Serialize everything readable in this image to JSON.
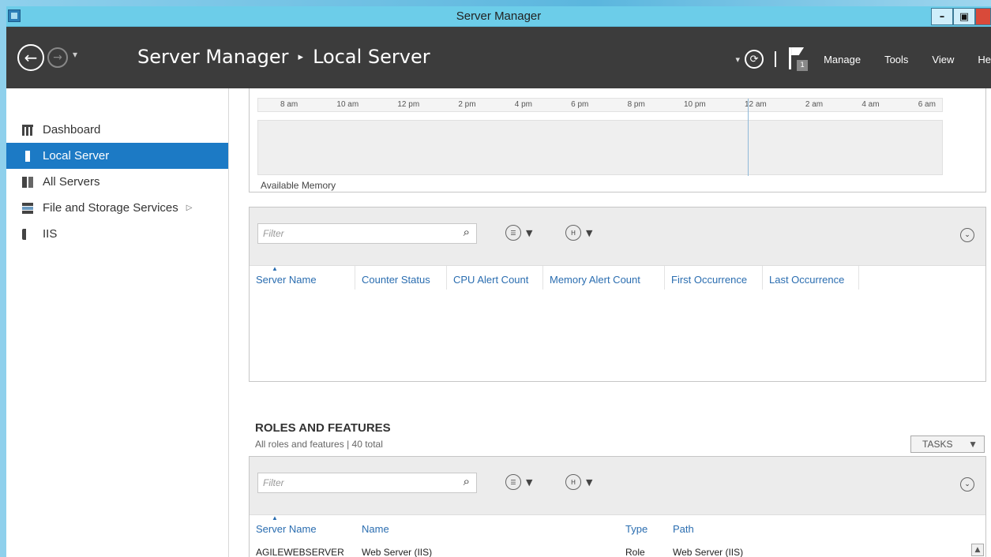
{
  "window": {
    "title": "Server Manager",
    "buttons": {
      "minimize": "–",
      "restore": "🗗",
      "close": ""
    }
  },
  "cmdbar": {
    "breadcrumb": [
      "Server Manager",
      "Local Server"
    ],
    "separator": "▸",
    "menus": [
      "Manage",
      "Tools",
      "View",
      "He"
    ],
    "notification_count": "1"
  },
  "sidebar": {
    "items": [
      {
        "label": "Dashboard",
        "icon": "dashboard-icon",
        "active": false
      },
      {
        "label": "Local Server",
        "icon": "server-icon",
        "active": true
      },
      {
        "label": "All Servers",
        "icon": "servers-icon",
        "active": false
      },
      {
        "label": "File and Storage Services",
        "icon": "storage-icon",
        "active": false,
        "has_submenu": true
      },
      {
        "label": "IIS",
        "icon": "iis-icon",
        "active": false
      }
    ]
  },
  "performance": {
    "time_ticks": [
      "8 am",
      "10 am",
      "12 pm",
      "2 pm",
      "4 pm",
      "6 pm",
      "8 pm",
      "10 pm",
      "12 am",
      "2 am",
      "4 am",
      "6 am"
    ],
    "chart_label": "Available Memory"
  },
  "alerts_table": {
    "filter_placeholder": "Filter",
    "columns": [
      "Server Name",
      "Counter Status",
      "CPU Alert Count",
      "Memory Alert Count",
      "First Occurrence",
      "Last Occurrence"
    ]
  },
  "roles": {
    "title": "ROLES AND FEATURES",
    "subtitle": "All roles and features | 40 total",
    "tasks_label": "TASKS",
    "filter_placeholder": "Filter",
    "columns": [
      "Server Name",
      "Name",
      "Type",
      "Path"
    ],
    "rows": [
      {
        "server": "AGILEWEBSERVER",
        "name": "Web Server (IIS)",
        "type": "Role",
        "path": "Web Server (IIS)"
      }
    ]
  },
  "colors": {
    "titlebar": "#6ccde9",
    "cmdbar": "#3c3c3c",
    "accent": "#1c7ac5",
    "link": "#2a6db0"
  }
}
